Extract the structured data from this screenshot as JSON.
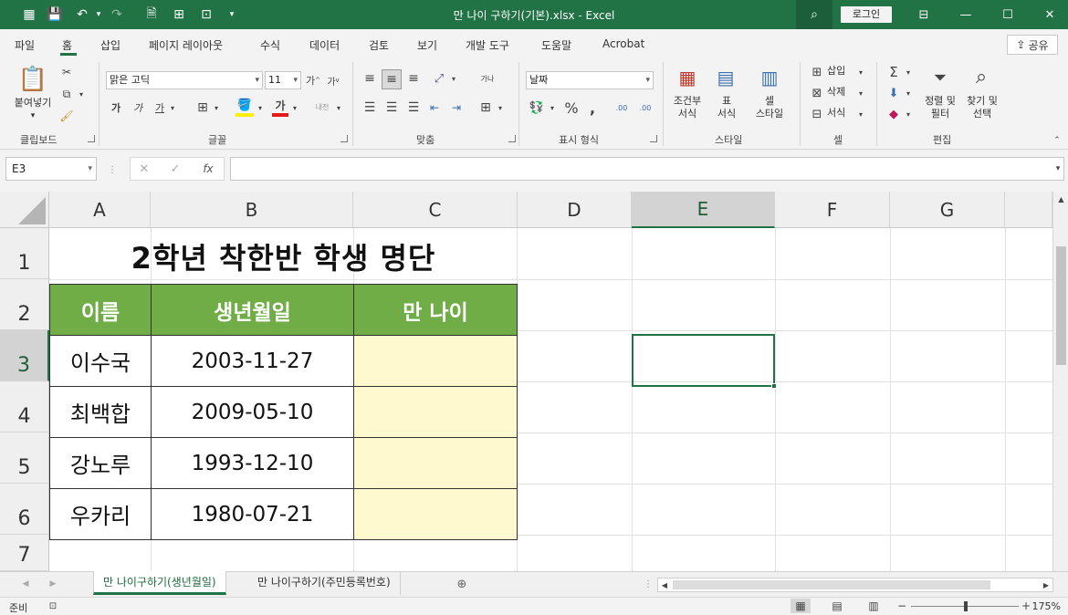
{
  "window": {
    "doc_title": "만 나이 구하기(기본).xlsx  -  Excel",
    "login_label": "로그인"
  },
  "menu": {
    "tabs": [
      "파일",
      "홈",
      "삽입",
      "페이지 레이아웃",
      "수식",
      "데이터",
      "검토",
      "보기",
      "개발 도구",
      "도움말",
      "Acrobat"
    ],
    "share_label": "공유"
  },
  "ribbon": {
    "clipboard": {
      "label": "클립보드",
      "paste_label": "붙여넣기"
    },
    "font": {
      "label": "글꼴",
      "font_name": "맑은 고딕",
      "font_size": "11",
      "grow": "가",
      "shrink": "가",
      "bold": "가",
      "italic": "가",
      "underline": "가",
      "font_color": "가",
      "phonetic": "내천"
    },
    "alignment": {
      "label": "맞춤",
      "wrap": "가나"
    },
    "number": {
      "label": "표시 형식",
      "format": "날짜"
    },
    "styles": {
      "label": "스타일",
      "cond_format": "조건부\n서식",
      "table_format": "표\n서식",
      "cell_styles": "셀\n스타일"
    },
    "cells": {
      "label": "셀",
      "insert": "삽입",
      "delete": "삭제",
      "format": "서식"
    },
    "editing": {
      "label": "편집",
      "sort_filter": "정렬 및\n필터",
      "find_select": "찾기 및\n선택"
    }
  },
  "formula_bar": {
    "name_box": "E3",
    "formula": ""
  },
  "columns": [
    "A",
    "B",
    "C",
    "D",
    "E",
    "F",
    "G"
  ],
  "rows": [
    "1",
    "2",
    "3",
    "4",
    "5",
    "6",
    "7"
  ],
  "selected": {
    "column": "E",
    "row": "3"
  },
  "sheet": {
    "title": "2학년 착한반 학생 명단",
    "headers": [
      "이름",
      "생년월일",
      "만 나이"
    ],
    "students": [
      {
        "name": "이수국",
        "birth": "2003-11-27",
        "age": ""
      },
      {
        "name": "최백합",
        "birth": "2009-05-10",
        "age": ""
      },
      {
        "name": "강노루",
        "birth": "1993-12-10",
        "age": ""
      },
      {
        "name": "우카리",
        "birth": "1980-07-21",
        "age": ""
      }
    ]
  },
  "sheet_tabs": [
    "만 나이구하기(생년월일)",
    "만 나이구하기(주민등록번호)"
  ],
  "status": {
    "mode": "준비",
    "zoom": "175%"
  },
  "colors": {
    "excel_green": "#217346",
    "header_fill": "#70ad47",
    "age_fill": "#fff9cf"
  }
}
